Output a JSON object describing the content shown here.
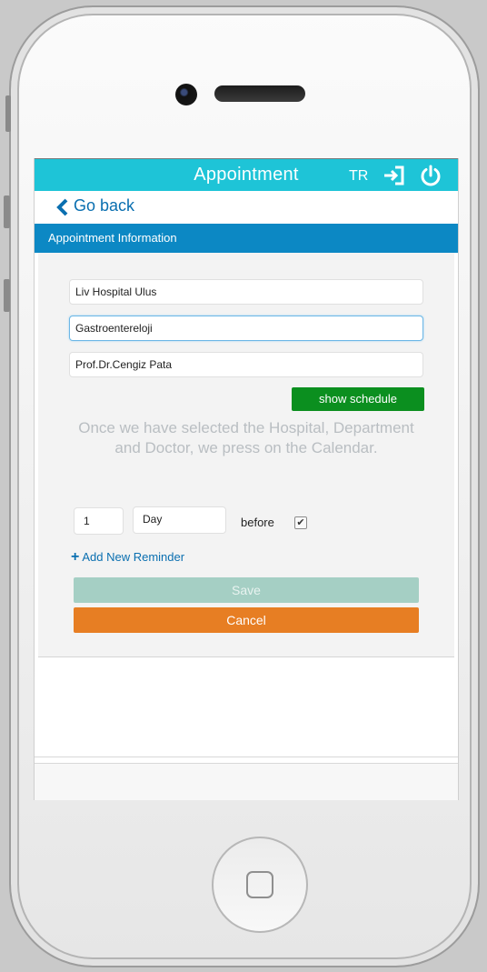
{
  "header": {
    "title": "Appointment",
    "language": "TR",
    "icons": {
      "exit": "exit-icon",
      "power": "power-icon"
    },
    "color": "#1ec4d7"
  },
  "nav": {
    "back_label": "Go back",
    "back_icon": "chevron-left-icon"
  },
  "section": {
    "title": "Appointment Information",
    "color": "#0c88c4"
  },
  "form": {
    "hospital": "Liv Hospital Ulus",
    "department": "Gastroentereloji",
    "doctor": "Prof.Dr.Cengiz Pata",
    "show_schedule_label": "show schedule",
    "info_text": "Once we have selected the Hospital, Department and Doctor, we press on the Calendar.",
    "reminder": {
      "amount": "1",
      "unit": "Day",
      "before_label": "before",
      "checked": true,
      "check_mark": "✔"
    },
    "add_reminder_label": "Add New Reminder",
    "add_reminder_icon": "plus-icon",
    "save_label": "Save",
    "cancel_label": "Cancel"
  },
  "colors": {
    "show_schedule": "#0b8f1f",
    "save": "#a5cfc4",
    "cancel": "#e77e23"
  }
}
